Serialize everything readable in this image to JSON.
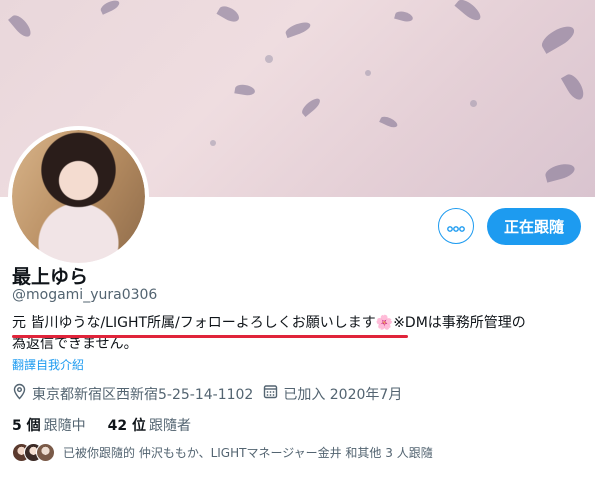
{
  "profile": {
    "display_name": "最上ゆら",
    "handle": "@mogami_yura0306",
    "bio_line1": "元 皆川ゆうな/LIGHT所属/フォローよろしくお願いします",
    "bio_emoji": "🌸",
    "bio_line1_tail": "※DMは事務所管理の",
    "bio_line2": "為返信できません。",
    "translate_link": "翻譯自我介紹",
    "location": "東京都新宿区西新宿5-25-14-1102",
    "joined": "已加入 2020年7月"
  },
  "actions": {
    "more_icon": "more-horizontal-icon",
    "follow_label": "正在跟隨"
  },
  "stats": {
    "following_count": "5 個",
    "following_label": "跟隨中",
    "followers_count": "42 位",
    "followers_label": "跟隨者"
  },
  "followed_by": {
    "text": "已被你跟隨的 仲沢ももか、LIGHTマネージャー金井 和其他 3 人跟隨"
  },
  "colors": {
    "accent": "#1d9bf0",
    "underline": "#e0243a",
    "muted": "#536471"
  }
}
